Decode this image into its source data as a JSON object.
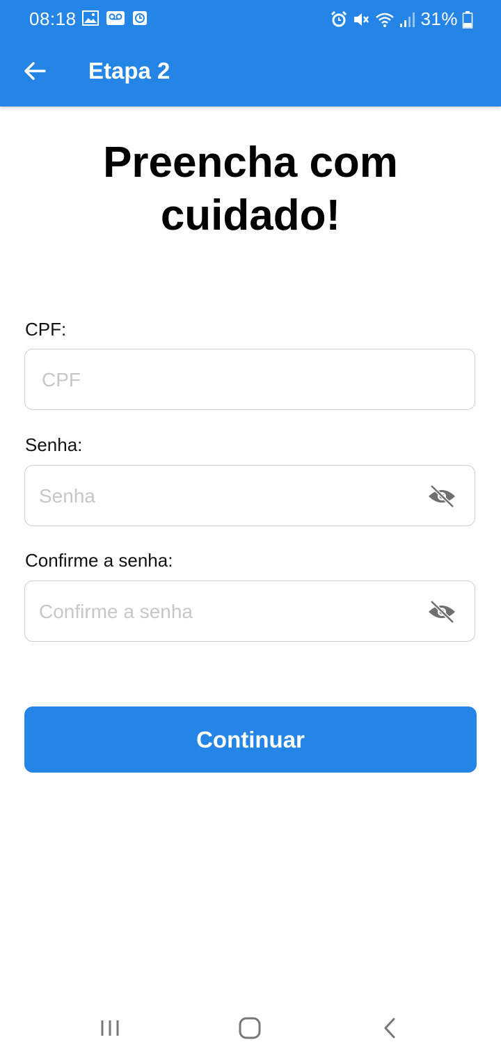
{
  "status_bar": {
    "time": "08:18",
    "battery": "31%",
    "left_icons": [
      "image-icon",
      "voicemail-icon",
      "clock-app-icon"
    ],
    "right_icons": [
      "alarm-icon",
      "mute-icon",
      "wifi-icon",
      "signal-icon",
      "battery-icon"
    ]
  },
  "toolbar": {
    "back_icon": "arrow-left-icon",
    "title": "Etapa 2",
    "color": "#2585e6"
  },
  "heading": {
    "line1": "Preencha com",
    "line2": "cuidado!"
  },
  "form": {
    "cpf": {
      "label": "CPF:",
      "placeholder": "CPF",
      "value": ""
    },
    "senha": {
      "label": "Senha:",
      "placeholder": "Senha",
      "value": "",
      "toggle_icon": "eye-off-icon"
    },
    "confirm": {
      "label": "Confirme a senha:",
      "placeholder": "Confirme a senha",
      "value": "",
      "toggle_icon": "eye-off-icon"
    }
  },
  "continue_button": {
    "label": "Continuar",
    "color": "#2585e6"
  },
  "nav_bar": {
    "icons": [
      "recent-apps-icon",
      "home-icon",
      "back-icon"
    ]
  }
}
